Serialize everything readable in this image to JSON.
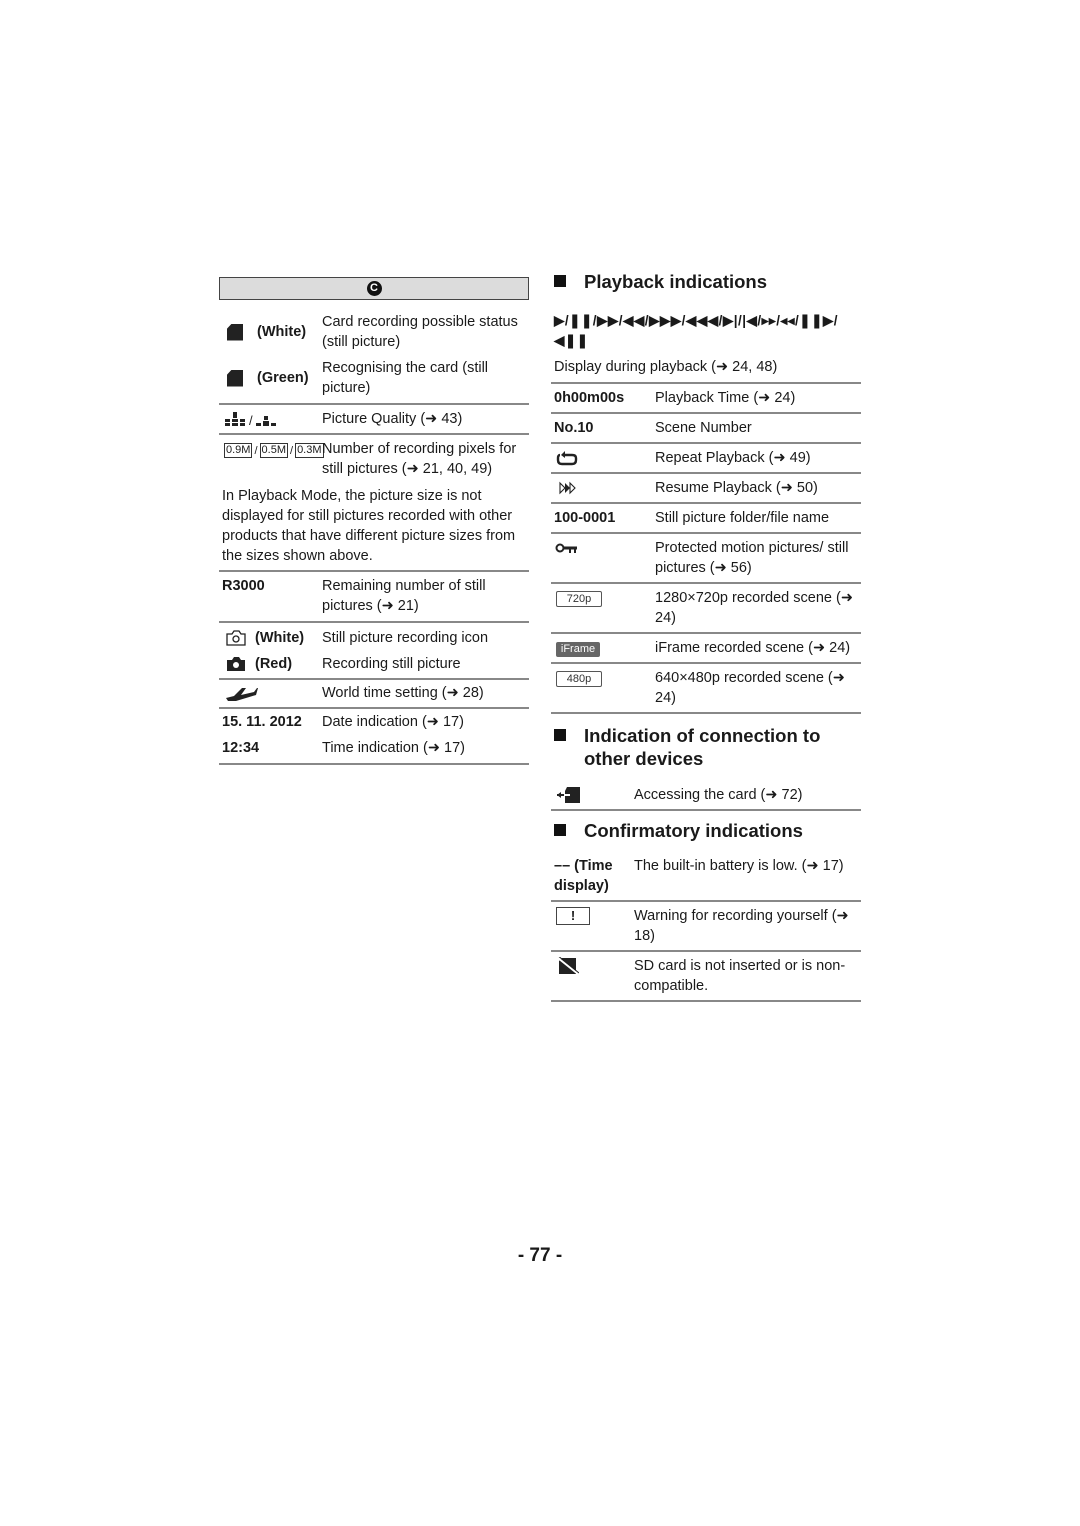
{
  "left": {
    "mode_icon": "C",
    "rows": [
      {
        "icon": "card-icon",
        "key": "(White)",
        "value": "Card recording possible status (still picture)"
      },
      {
        "icon": "card-icon",
        "key": "(Green)",
        "value": "Recognising the card (still picture)"
      },
      {
        "icon": "picture-quality-icon",
        "key": "",
        "value": "Picture Quality (➜ 43)"
      },
      {
        "icon": "recording-pixels-icon",
        "key": "",
        "value": "Number of recording pixels for still pictures (➜ 21, 40, 49)"
      }
    ],
    "pixel_badges": [
      "0.9M",
      "0.5M",
      "0.3M"
    ],
    "note": "In Playback Mode, the picture size is not displayed for still pictures recorded with other products that have different picture sizes from the sizes shown above.",
    "remaining": {
      "key": "R3000",
      "value": "Remaining number of still pictures (➜ 21)"
    },
    "camera_rows": [
      {
        "icon": "camera-outline-icon",
        "key": "(White)",
        "value": "Still picture recording icon"
      },
      {
        "icon": "camera-filled-icon",
        "key": "(Red)",
        "value": "Recording still picture"
      }
    ],
    "world_time": {
      "icon": "airplane-icon",
      "value": "World time setting (➜ 28)"
    },
    "date": {
      "key": "15. 11. 2012",
      "value": "Date indication (➜ 17)"
    },
    "time": {
      "key": "12:34",
      "value": "Time indication (➜ 17)"
    }
  },
  "right": {
    "playback": {
      "heading": "Playback indications",
      "controls_line1": "▶/❚❚/▶▶/◀◀/▶▶▶/◀◀◀/▶|/|◀/▸▸/◂◂/❚❚▶/",
      "controls_line2": "◀❚❚",
      "controls_desc": "Display during playback (➜ 24, 48)",
      "rows": [
        {
          "key": "0h00m00s",
          "value": "Playback Time (➜ 24)"
        },
        {
          "key": "No.10",
          "value": "Scene Number"
        },
        {
          "icon": "repeat-icon",
          "value": "Repeat Playback (➜ 49)"
        },
        {
          "icon": "resume-icon",
          "value": "Resume Playback (➜ 50)"
        },
        {
          "key": "100-0001",
          "value": "Still picture folder/file name"
        },
        {
          "icon": "protect-key-icon",
          "value": "Protected motion pictures/ still pictures (➜ 56)"
        },
        {
          "badge": "720p",
          "value": "1280×720p recorded scene (➜ 24)"
        },
        {
          "badge": "iFrame",
          "value": "iFrame recorded scene (➜ 24)"
        },
        {
          "badge": "480p",
          "value": "640×480p recorded scene (➜ 24)"
        }
      ]
    },
    "connection": {
      "heading": "Indication of connection to other devices",
      "rows": [
        {
          "icon": "card-access-icon",
          "value": "Accessing the card (➜ 72)"
        }
      ]
    },
    "confirmatory": {
      "heading": "Confirmatory indications",
      "rows": [
        {
          "key": "–– (Time display)",
          "value": "The built-in battery is low. (➜ 17)"
        },
        {
          "badge": "!",
          "value": "Warning for recording yourself (➜ 18)"
        },
        {
          "icon": "no-card-icon",
          "value": "SD card is not inserted or is non-compatible."
        }
      ]
    }
  },
  "page_number": "- 77 -"
}
